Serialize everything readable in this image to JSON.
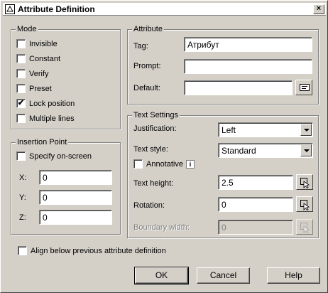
{
  "window": {
    "title": "Attribute Definition",
    "close_glyph": "×"
  },
  "mode": {
    "title": "Mode",
    "options": [
      {
        "label": "Invisible",
        "checked": false
      },
      {
        "label": "Constant",
        "checked": false
      },
      {
        "label": "Verify",
        "checked": false
      },
      {
        "label": "Preset",
        "checked": false
      },
      {
        "label": "Lock position",
        "checked": true
      },
      {
        "label": "Multiple lines",
        "checked": false
      }
    ]
  },
  "attribute": {
    "title": "Attribute",
    "tag_label": "Tag:",
    "tag_value": "Атрибут",
    "prompt_label": "Prompt:",
    "prompt_value": "",
    "default_label": "Default:",
    "default_value": "",
    "field_icon": "insert-field-icon"
  },
  "insertion_point": {
    "title": "Insertion Point",
    "specify_label": "Specify on-screen",
    "specify_checked": false,
    "x_label": "X:",
    "x_value": "0",
    "y_label": "Y:",
    "y_value": "0",
    "z_label": "Z:",
    "z_value": "0"
  },
  "text_settings": {
    "title": "Text Settings",
    "justification_label": "Justification:",
    "justification_value": "Left",
    "text_style_label": "Text style:",
    "text_style_value": "Standard",
    "annotative_label": "Annotative",
    "annotative_checked": false,
    "info_glyph": "i",
    "text_height_label": "Text height:",
    "text_height_value": "2.5",
    "rotation_label": "Rotation:",
    "rotation_value": "0",
    "boundary_width_label": "Boundary width:",
    "boundary_width_value": "0"
  },
  "align_below": {
    "label": "Align below previous attribute definition",
    "checked": false
  },
  "buttons": {
    "ok": "OK",
    "cancel": "Cancel",
    "help": "Help"
  },
  "check_glyph": "✔"
}
